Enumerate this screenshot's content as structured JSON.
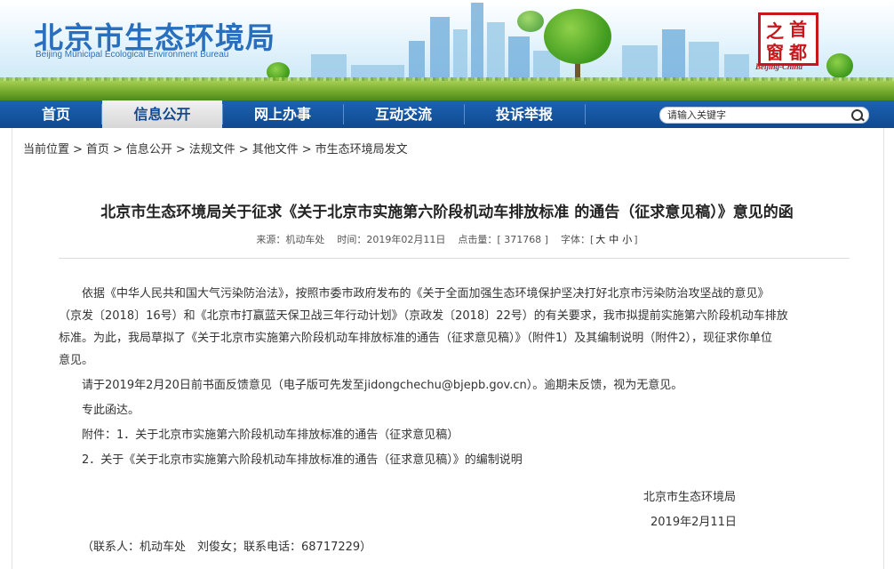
{
  "header": {
    "title_cn": "北京市生态环境局",
    "title_en": "Beijing Municipal Ecological Environment Bureau",
    "seal_chars": [
      "首",
      "之",
      "都",
      "窗"
    ],
    "seal_en": "Beijing-China"
  },
  "nav": {
    "items": [
      {
        "label": "首页"
      },
      {
        "label": "信息公开",
        "active": true
      },
      {
        "label": "网上办事"
      },
      {
        "label": "互动交流"
      },
      {
        "label": "投诉举报"
      }
    ],
    "search_placeholder": "请输入关键字"
  },
  "breadcrumb": {
    "prefix": "当前位置",
    "items": [
      "首页",
      "信息公开",
      "法规文件",
      "其他文件",
      "市生态环境局发文"
    ],
    "separator": ">"
  },
  "article": {
    "title": "北京市生态环境局关于征求《关于北京市实施第六阶段机动车排放标准 的通告（征求意见稿）》意见的函",
    "meta": {
      "source": "来源：机动车处",
      "time": "时间：2019年02月11日",
      "hits": "点击量：[ 371768 ]",
      "font_label": "字体：",
      "font_open": "[",
      "font_sizes": [
        "大",
        "中",
        "小"
      ],
      "font_close": "]"
    },
    "paragraph1_lines": [
      "依据《中华人民共和国大气污染防治法》，按照市委市政府发布的《关于全面加强生态环境保护坚决打好北京市污染防治攻坚战的意见》",
      "（京发〔2018〕16号）和《北京市打赢蓝天保卫战三年行动计划》（京政发〔2018〕22号）的有关要求，我市拟提前实施第六阶段机动车排放",
      "标准。为此，我局草拟了《关于北京市实施第六阶段机动车排放标准的通告（征求意见稿）》（附件1）及其编制说明（附件2），现征求你单位",
      "意见。"
    ],
    "paragraph2": "请于2019年2月20日前书面反馈意见（电子版可先发至jidongchechu@bjepb.gov.cn）。逾期未反馈，视为无意见。",
    "paragraph3": "专此函达。",
    "attachment1": "附件：1．关于北京市实施第六阶段机动车排放标准的通告（征求意见稿）",
    "attachment2": "2．关于《关于北京市实施第六阶段机动车排放标准的通告（征求意见稿）》的编制说明",
    "signature": "北京市生态环境局",
    "date": "2019年2月11日",
    "contact": "（联系人：机动车处　刘俊女；联系电话：68717229）"
  },
  "colors": {
    "brand_blue": "#2a6fbd",
    "nav_blue": "#10498f",
    "seal_red": "#c8161d"
  }
}
